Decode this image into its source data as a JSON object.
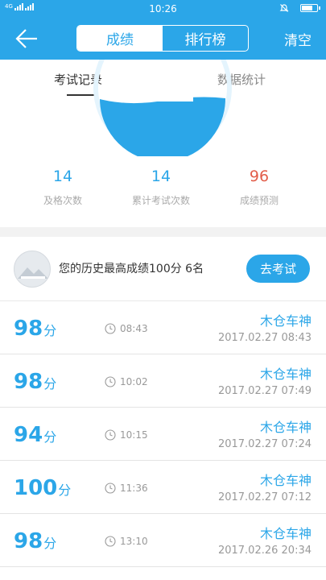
{
  "status": {
    "time": "10:26",
    "network": "4G",
    "battery_level": 0.7
  },
  "nav": {
    "tabs": [
      {
        "label": "成绩",
        "active": true
      },
      {
        "label": "排行榜",
        "active": false
      }
    ],
    "clear_label": "清空"
  },
  "subtabs": [
    {
      "label": "考试记录",
      "active": true
    },
    {
      "label": "数据统计",
      "active": false
    }
  ],
  "stats": [
    {
      "value": "14",
      "label": "及格次数"
    },
    {
      "value": "14",
      "label": "累计考试次数"
    },
    {
      "value": "96",
      "label": "成绩预测"
    }
  ],
  "best": {
    "text": "您的历史最高成绩100分  6名",
    "button_label": "去考试"
  },
  "records": [
    {
      "score": "98",
      "unit": "分",
      "duration": "08:43",
      "user": "木仓车神",
      "date": "2017.02.27  08:43"
    },
    {
      "score": "98",
      "unit": "分",
      "duration": "10:02",
      "user": "木仓车神",
      "date": "2017.02.27  07:49"
    },
    {
      "score": "94",
      "unit": "分",
      "duration": "10:15",
      "user": "木仓车神",
      "date": "2017.02.27  07:24"
    },
    {
      "score": "100",
      "unit": "分",
      "duration": "11:36",
      "user": "木仓车神",
      "date": "2017.02.27  07:12"
    },
    {
      "score": "98",
      "unit": "分",
      "duration": "13:10",
      "user": "木仓车神",
      "date": "2017.02.26  20:34"
    }
  ],
  "colors": {
    "primary": "#2ba6e8",
    "prediction": "#e25d4a"
  }
}
